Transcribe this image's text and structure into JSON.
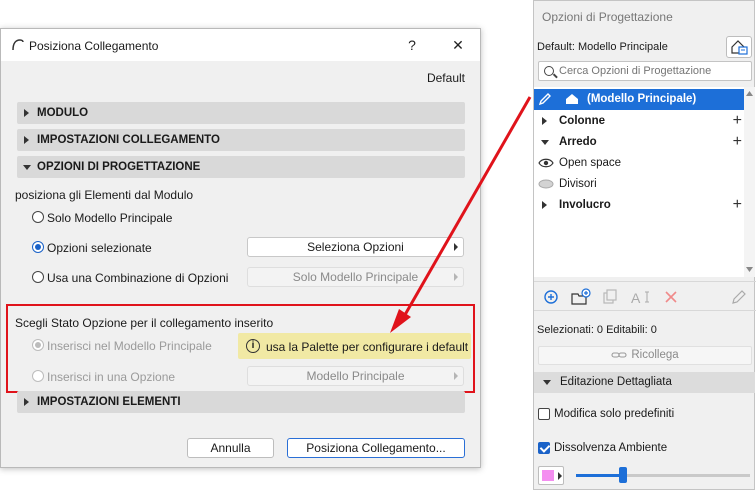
{
  "dialog": {
    "title": "Posiziona Collegamento",
    "help": "?",
    "close": "✕",
    "default_label": "Default",
    "sections": {
      "modulo": "MODULO",
      "impostazioni_collegamento": "IMPOSTAZIONI COLLEGAMENTO",
      "opzioni_progettazione": "OPZIONI DI PROGETTAZIONE",
      "impostazioni_elementi": "IMPOSTAZIONI ELEMENTI"
    },
    "place_label": "posiziona gli Elementi dal Modulo",
    "radio_main": "Solo Modello Principale",
    "radio_selected": "Opzioni selezionate",
    "radio_combination": "Usa una Combinazione di Opzioni",
    "btn_select_options": "Seleziona Opzioni",
    "combo_value": "Solo Modello Principale",
    "state_label": "Scegli Stato Opzione per il collegamento inserito",
    "radio_insert_main": "Inserisci nel Modello Principale",
    "radio_insert_option": "Inserisci in una Opzione",
    "info_text": "usa la Palette per configurare i default",
    "option_value": "Modello Principale",
    "cancel": "Annulla",
    "ok": "Posiziona Collegamento..."
  },
  "palette": {
    "title": "Opzioni di Progettazione",
    "default_label": "Default: Modello Principale",
    "search_placeholder": "Cerca Opzioni di Progettazione",
    "rows": [
      {
        "label": "(Modello Principale)"
      },
      {
        "label": "Colonne"
      },
      {
        "label": "Arredo"
      },
      {
        "label": "Open space"
      },
      {
        "label": "Divisori"
      },
      {
        "label": "Involucro"
      }
    ],
    "selected_info": "Selezionati: 0 Editabili: 0",
    "relink": "Ricollega",
    "detail_section": "Editazione Dettagliata",
    "chk_defaults": "Modifica solo predefiniti",
    "chk_fade": "Dissolvenza Ambiente",
    "fade_level": 0.27
  },
  "colors": {
    "accent": "#1d6fd8",
    "highlight_red": "#e0131b",
    "info_bg": "#f1e9a4",
    "swatch": "#f48ef0"
  }
}
